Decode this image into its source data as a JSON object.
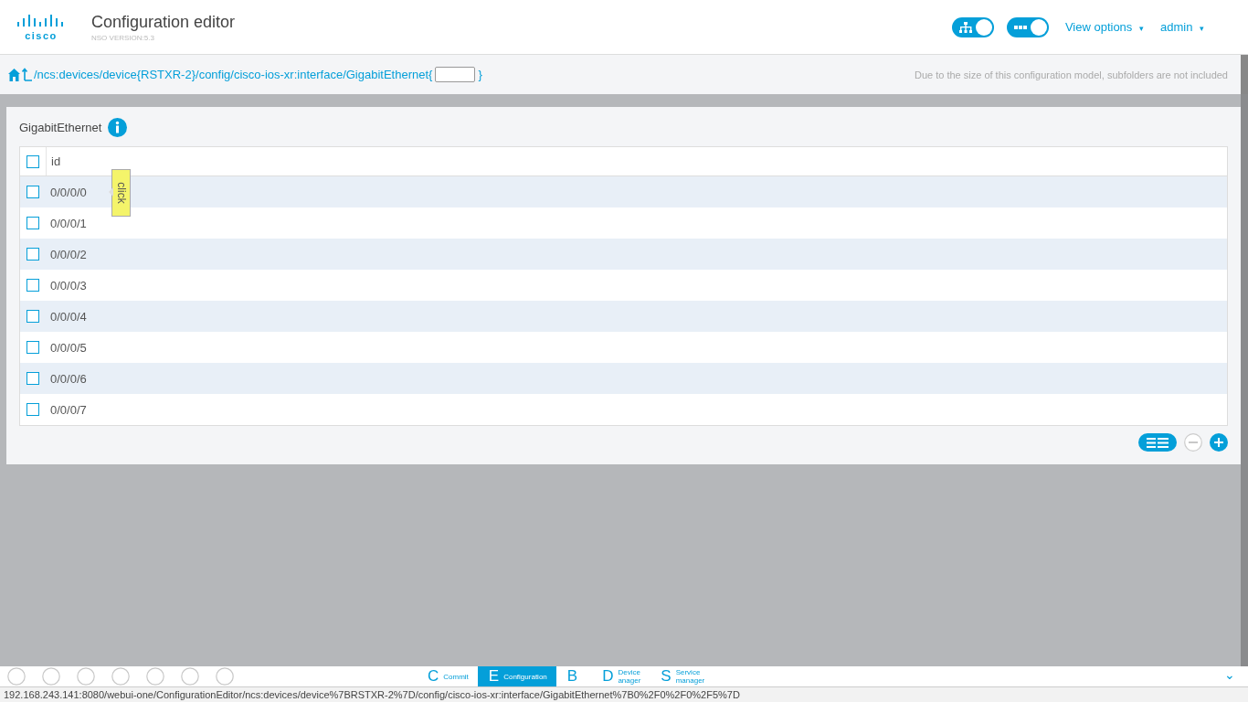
{
  "header": {
    "logo": "cisco",
    "title": "Configuration editor",
    "version": "NSO VERSION:5.3",
    "toggles": [
      {
        "kind": "tree",
        "on": true
      },
      {
        "kind": "dots",
        "on": true
      }
    ],
    "menus": [
      {
        "label": "View options",
        "caret": "▾"
      },
      {
        "label": "admin",
        "caret": "▾"
      }
    ]
  },
  "breadcrumb": {
    "path": "/ncs:devices/device{RSTXR-2}/config/cisco-ios-xr:interface/GigabitEthernet{",
    "suffix": "}",
    "note": "Due to the size of this configuration model, subfolders are not included"
  },
  "panel": {
    "title": "GigabitEthernet",
    "table": {
      "column": "id",
      "header_checked": false,
      "rows": [
        {
          "id": "0/0/0/0",
          "checked": false
        },
        {
          "id": "0/0/0/1",
          "checked": false
        },
        {
          "id": "0/0/0/2",
          "checked": false
        },
        {
          "id": "0/0/0/3",
          "checked": false
        },
        {
          "id": "0/0/0/4",
          "checked": false
        },
        {
          "id": "0/0/0/5",
          "checked": false
        },
        {
          "id": "0/0/0/6",
          "checked": false
        },
        {
          "id": "0/0/0/7",
          "checked": false
        }
      ]
    }
  },
  "tooltip": {
    "text": "click"
  },
  "dock": [
    {
      "letter": "C",
      "lines": [
        "Commit"
      ],
      "selected": false
    },
    {
      "letter": "E",
      "lines": [
        "Configuration"
      ],
      "selected": true
    },
    {
      "letter": "B",
      "selected": false
    },
    {
      "letter": "D",
      "lines": [
        "Device",
        "anager"
      ],
      "selected": false
    },
    {
      "letter": "S",
      "lines": [
        "Service",
        "manager"
      ],
      "selected": false
    }
  ],
  "dock_expander": "⌄",
  "status_url": "192.168.243.141:8080/webui-one/ConfigurationEditor/ncs:devices/device%7BRSTXR-2%7D/config/cisco-ios-xr:interface/GigabitEthernet%7B0%2F0%2F0%2F5%7D"
}
